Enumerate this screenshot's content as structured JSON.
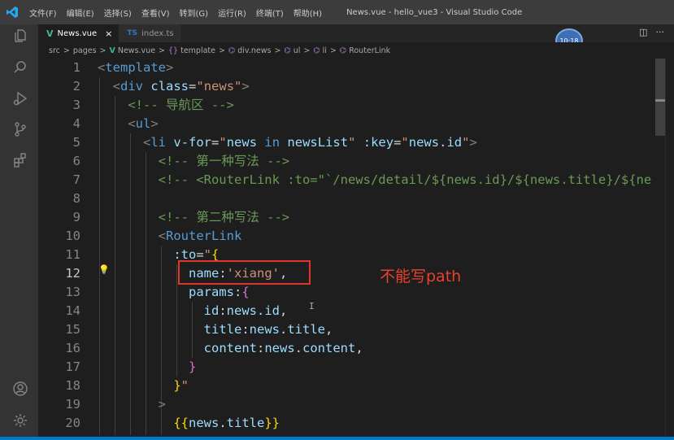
{
  "titlebar": {
    "menu": [
      "文件(F)",
      "编辑(E)",
      "选择(S)",
      "查看(V)",
      "转到(G)",
      "运行(R)",
      "终端(T)",
      "帮助(H)"
    ],
    "window_title": "News.vue - hello_vue3 - Visual Studio Code"
  },
  "tabs": [
    {
      "icon": "V",
      "label": "News.vue",
      "close": "×"
    },
    {
      "icon": "TS",
      "label": "index.ts"
    }
  ],
  "tab_actions": {
    "split": "◫",
    "more": "···"
  },
  "avatar_text": "10:18",
  "breadcrumb": {
    "items": [
      "src",
      "pages",
      "News.vue",
      "template",
      "div.news",
      "ul",
      "li",
      "RouterLink"
    ],
    "sep": ">"
  },
  "editor": {
    "current_line": 12,
    "lines": [
      {
        "n": "1",
        "segs": [
          [
            "t-br",
            "<"
          ],
          [
            "t-tag",
            "template"
          ],
          [
            "t-br",
            ">"
          ]
        ]
      },
      {
        "n": "2",
        "segs": [
          [
            "t-txt",
            "  "
          ],
          [
            "t-br",
            "<"
          ],
          [
            "t-tag",
            "div"
          ],
          [
            "t-txt",
            " "
          ],
          [
            "t-attr",
            "class"
          ],
          [
            "t-txt",
            "="
          ],
          [
            "t-str",
            "\"news\""
          ],
          [
            "t-br",
            ">"
          ]
        ]
      },
      {
        "n": "3",
        "segs": [
          [
            "t-txt",
            "    "
          ],
          [
            "t-cmt",
            "<!-- 导航区 -->"
          ]
        ]
      },
      {
        "n": "4",
        "segs": [
          [
            "t-txt",
            "    "
          ],
          [
            "t-br",
            "<"
          ],
          [
            "t-tag",
            "ul"
          ],
          [
            "t-br",
            ">"
          ]
        ]
      },
      {
        "n": "5",
        "segs": [
          [
            "t-txt",
            "      "
          ],
          [
            "t-br",
            "<"
          ],
          [
            "t-tag",
            "li"
          ],
          [
            "t-txt",
            " "
          ],
          [
            "t-attr",
            "v-for"
          ],
          [
            "t-txt",
            "="
          ],
          [
            "t-str",
            "\""
          ],
          [
            "t-var",
            "news"
          ],
          [
            "t-txt",
            " "
          ],
          [
            "t-kw",
            "in"
          ],
          [
            "t-txt",
            " "
          ],
          [
            "t-var",
            "newsList"
          ],
          [
            "t-str",
            "\""
          ],
          [
            "t-txt",
            " "
          ],
          [
            "t-attr",
            ":key"
          ],
          [
            "t-txt",
            "="
          ],
          [
            "t-str",
            "\""
          ],
          [
            "t-var",
            "news"
          ],
          [
            "t-txt",
            "."
          ],
          [
            "t-var",
            "id"
          ],
          [
            "t-str",
            "\""
          ],
          [
            "t-br",
            ">"
          ]
        ]
      },
      {
        "n": "6",
        "segs": [
          [
            "t-txt",
            "        "
          ],
          [
            "t-cmt",
            "<!-- 第一种写法 -->"
          ]
        ]
      },
      {
        "n": "7",
        "segs": [
          [
            "t-txt",
            "        "
          ],
          [
            "t-cmt",
            "<!-- <RouterLink :to=\"`/news/detail/${news.id}/${news.title}/${ne"
          ]
        ]
      },
      {
        "n": "8",
        "segs": []
      },
      {
        "n": "9",
        "segs": [
          [
            "t-txt",
            "        "
          ],
          [
            "t-cmt",
            "<!-- 第二种写法 -->"
          ]
        ]
      },
      {
        "n": "10",
        "segs": [
          [
            "t-txt",
            "        "
          ],
          [
            "t-br",
            "<"
          ],
          [
            "t-tag",
            "RouterLink"
          ]
        ]
      },
      {
        "n": "11",
        "segs": [
          [
            "t-txt",
            "          "
          ],
          [
            "t-attr",
            ":to"
          ],
          [
            "t-txt",
            "="
          ],
          [
            "t-str",
            "\""
          ],
          [
            "t-ybr",
            "{"
          ]
        ]
      },
      {
        "n": "12",
        "segs": [
          [
            "t-txt",
            "            "
          ],
          [
            "t-var",
            "name"
          ],
          [
            "t-txt",
            ":"
          ],
          [
            "t-str",
            "'xiang'"
          ],
          [
            "t-txt",
            ","
          ]
        ]
      },
      {
        "n": "13",
        "segs": [
          [
            "t-txt",
            "            "
          ],
          [
            "t-var",
            "params"
          ],
          [
            "t-txt",
            ":"
          ],
          [
            "t-pbr",
            "{"
          ]
        ]
      },
      {
        "n": "14",
        "segs": [
          [
            "t-txt",
            "              "
          ],
          [
            "t-var",
            "id"
          ],
          [
            "t-txt",
            ":"
          ],
          [
            "t-var",
            "news"
          ],
          [
            "t-txt",
            "."
          ],
          [
            "t-var",
            "id"
          ],
          [
            "t-txt",
            ","
          ]
        ]
      },
      {
        "n": "15",
        "segs": [
          [
            "t-txt",
            "              "
          ],
          [
            "t-var",
            "title"
          ],
          [
            "t-txt",
            ":"
          ],
          [
            "t-var",
            "news"
          ],
          [
            "t-txt",
            "."
          ],
          [
            "t-var",
            "title"
          ],
          [
            "t-txt",
            ","
          ]
        ]
      },
      {
        "n": "16",
        "segs": [
          [
            "t-txt",
            "              "
          ],
          [
            "t-var",
            "content"
          ],
          [
            "t-txt",
            ":"
          ],
          [
            "t-var",
            "news"
          ],
          [
            "t-txt",
            "."
          ],
          [
            "t-var",
            "content"
          ],
          [
            "t-txt",
            ","
          ]
        ]
      },
      {
        "n": "17",
        "segs": [
          [
            "t-txt",
            "            "
          ],
          [
            "t-pbr",
            "}"
          ]
        ]
      },
      {
        "n": "18",
        "segs": [
          [
            "t-txt",
            "          "
          ],
          [
            "t-ybr",
            "}"
          ],
          [
            "t-str",
            "\""
          ]
        ]
      },
      {
        "n": "19",
        "segs": [
          [
            "t-txt",
            "        "
          ],
          [
            "t-br",
            ">"
          ]
        ]
      },
      {
        "n": "20",
        "segs": [
          [
            "t-txt",
            "          "
          ],
          [
            "t-ybr",
            "{{"
          ],
          [
            "t-var",
            "news"
          ],
          [
            "t-txt",
            "."
          ],
          [
            "t-var",
            "title"
          ],
          [
            "t-ybr",
            "}}"
          ]
        ]
      }
    ]
  },
  "annotation": "不能写path",
  "colors": {
    "annotation": "#e8412c",
    "highlight_box": "#e0352b",
    "vue_green": "#41b883",
    "status_blue": "#007acc"
  }
}
